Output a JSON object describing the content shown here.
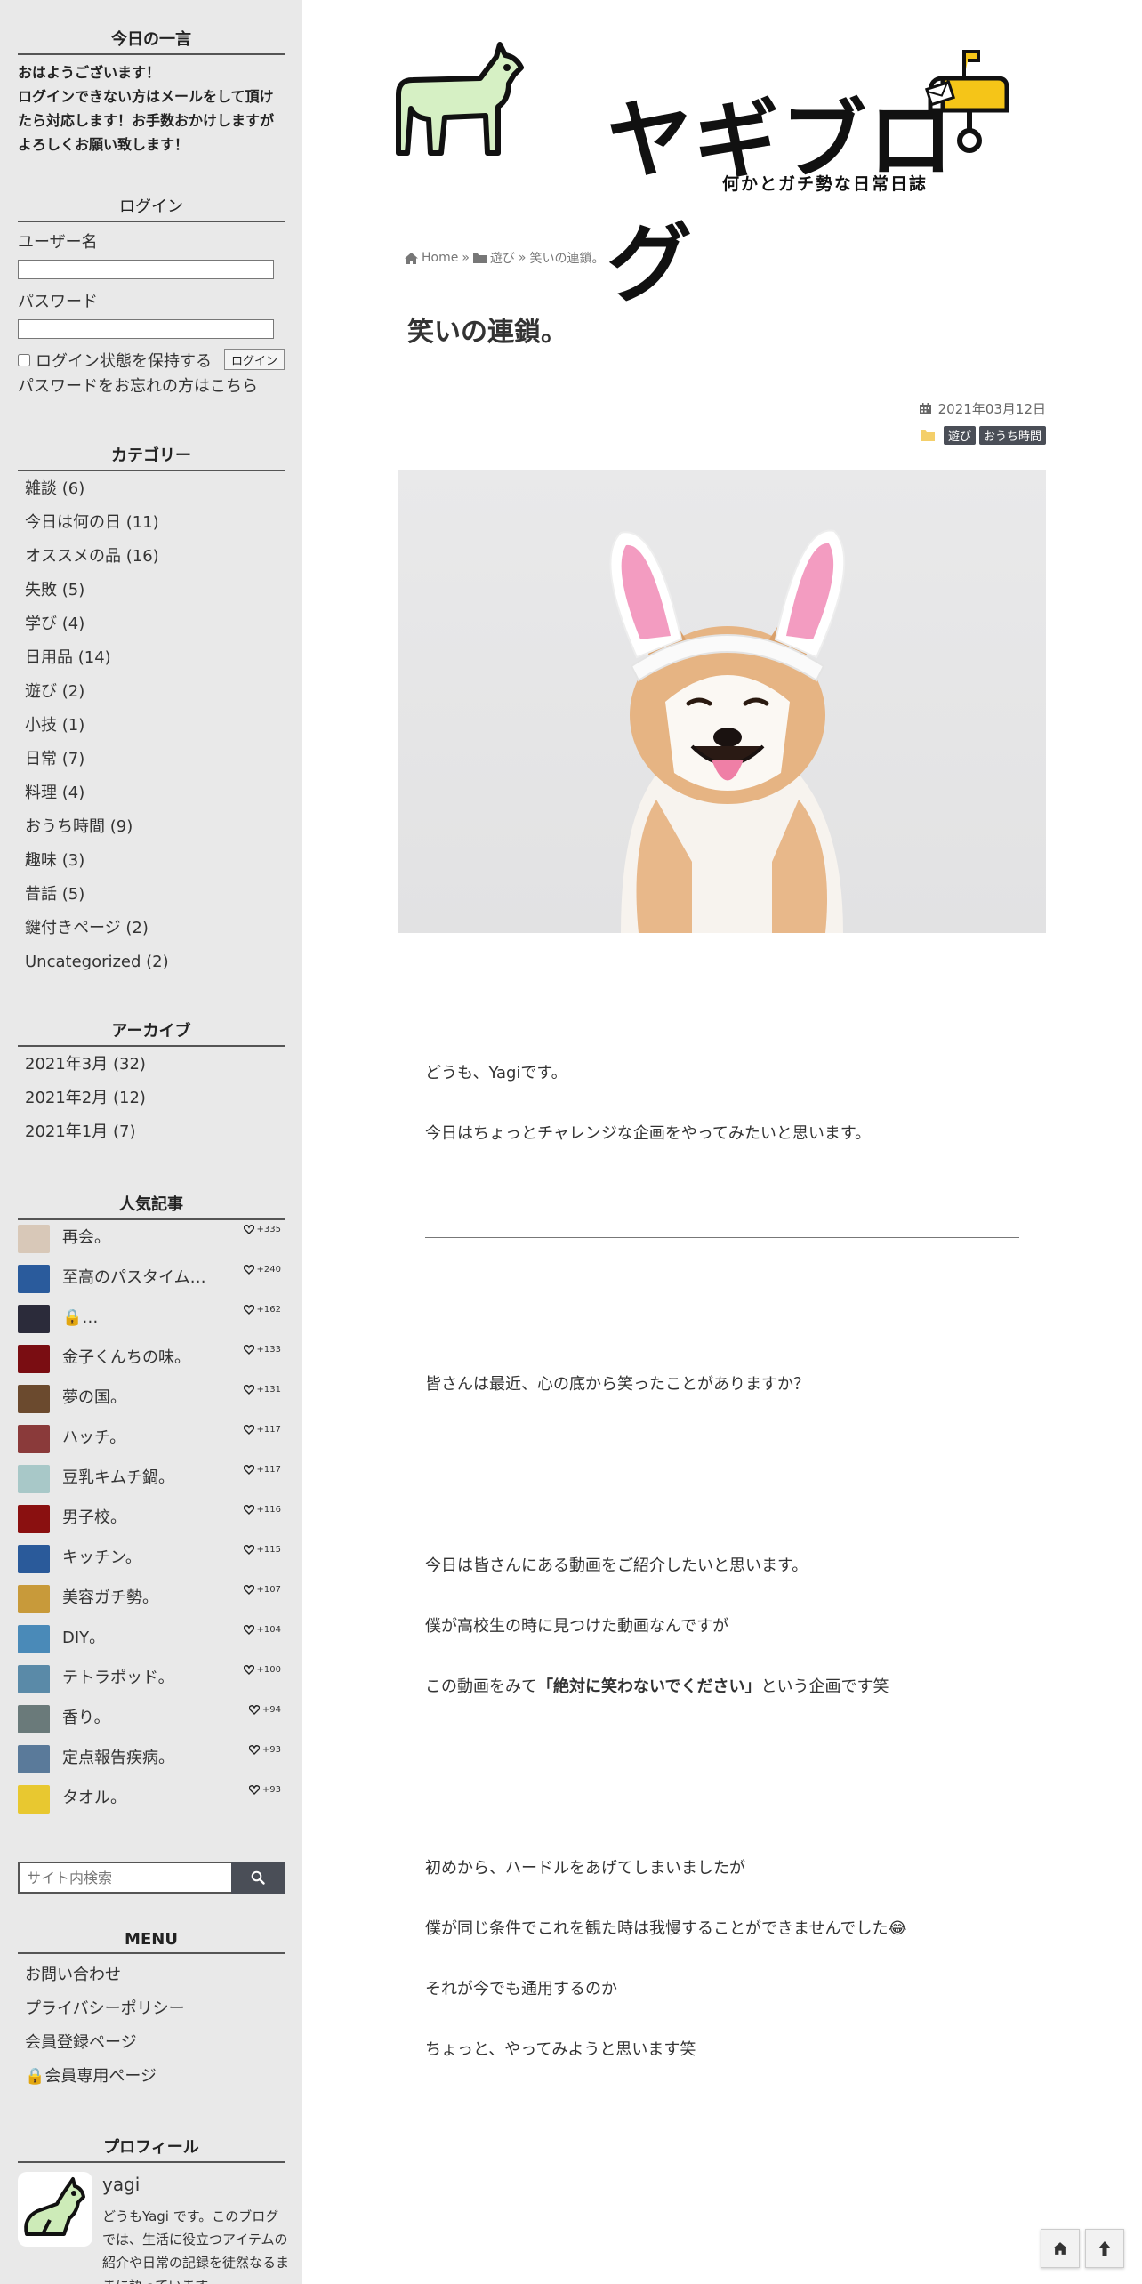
{
  "sidebar": {
    "greeting": {
      "title": "今日の一言",
      "lines": [
        "おはようございます！",
        "ログインできない方はメールをして頂け",
        "たら対応します！お手数おかけしますが",
        "よろしくお願い致します！"
      ]
    },
    "login": {
      "title": "ログイン",
      "username_label": "ユーザー名",
      "password_label": "パスワード",
      "remember_label": "ログイン状態を保持する",
      "login_button": "ログイン",
      "forgot_link": "パスワードをお忘れの方はこちら"
    },
    "categories": {
      "title": "カテゴリー",
      "items": [
        "雑談 (6)",
        "今日は何の日 (11)",
        "オススメの品 (16)",
        "失敗 (5)",
        "学び (4)",
        "日用品 (14)",
        "遊び (2)",
        "小技 (1)",
        "日常 (7)",
        "料理 (4)",
        "おうち時間 (9)",
        "趣味 (3)",
        "昔話 (5)",
        "鍵付きページ (2)",
        "Uncategorized (2)"
      ]
    },
    "archive": {
      "title": "アーカイブ",
      "items": [
        "2021年3月 (32)",
        "2021年2月 (12)",
        "2021年1月 (7)"
      ]
    },
    "popular": {
      "title": "人気記事",
      "items": [
        {
          "title": "再会。",
          "count": "+335",
          "color": "#d8c8b8"
        },
        {
          "title": "至高のパスタイム…",
          "count": "+240",
          "color": "#2a5b9c"
        },
        {
          "title": "🔒…",
          "count": "+162",
          "color": "#2b2b3a"
        },
        {
          "title": "金子くんちの味。",
          "count": "+133",
          "color": "#7a0d12"
        },
        {
          "title": "夢の国。",
          "count": "+131",
          "color": "#6b4a2e"
        },
        {
          "title": "ハッチ。",
          "count": "+117",
          "color": "#8a3a3a"
        },
        {
          "title": "豆乳キムチ鍋。",
          "count": "+117",
          "color": "#a8c8c8"
        },
        {
          "title": "男子校。",
          "count": "+116",
          "color": "#8a1010"
        },
        {
          "title": "キッチン。",
          "count": "+115",
          "color": "#2a5a9a"
        },
        {
          "title": "美容ガチ勢。",
          "count": "+107",
          "color": "#c89a3a"
        },
        {
          "title": "DIY。",
          "count": "+104",
          "color": "#4a8ab8"
        },
        {
          "title": "テトラポッド。",
          "count": "+100",
          "color": "#5a8aa8"
        },
        {
          "title": "香り。",
          "count": "+94",
          "color": "#6a7a7a"
        },
        {
          "title": "定点報告疾病。",
          "count": "+93",
          "color": "#5a7a9a"
        },
        {
          "title": "タオル。",
          "count": "+93",
          "color": "#e8c830"
        }
      ]
    },
    "search": {
      "placeholder": "サイト内検索"
    },
    "menu": {
      "title": "MENU",
      "items": [
        "お問い合わせ",
        "プライバシーポリシー",
        "会員登録ページ",
        "🔒会員専用ページ"
      ]
    },
    "profile": {
      "title": "プロフィール",
      "name": "yagi",
      "desc": "どうもYagi です。このブログでは、生活に役立つアイテムの紹介や日常の記録を徒然なるままに語っています。"
    }
  },
  "header": {
    "logo_title": "ヤギブログ",
    "logo_subtitle": "何かとガチ勢な日常日誌"
  },
  "breadcrumb": {
    "home": "Home",
    "sep": "»",
    "category": "遊び",
    "current": "笑いの連鎖。"
  },
  "post": {
    "title": "笑いの連鎖。",
    "date": "2021年03月12日",
    "tags": [
      "遊び",
      "おうち時間"
    ],
    "paragraphs": {
      "p1": "どうも、Yagiです。",
      "p2": "今日はちょっとチャレンジな企画をやってみたいと思います。",
      "p3": "皆さんは最近、心の底から笑ったことがありますか？",
      "p4": "今日は皆さんにある動画をご紹介したいと思います。",
      "p5": "僕が高校生の時に見つけた動画なんですが",
      "p6_pre": "この動画をみて",
      "p6_bold": "「絶対に笑わないでください」",
      "p6_post": "という企画です笑",
      "p7": "初めから、ハードルをあげてしまいましたが",
      "p8": "僕が同じ条件でこれを観た時は我慢することができませんでした😂",
      "p9": "それが今でも通用するのか",
      "p10": "ちょっと、やってみようと思います笑"
    }
  },
  "colors": {
    "sidebar_bg": "#e9e9e9",
    "tag_bg": "#4a4e57",
    "logo_goat": "#d6f0c4",
    "logo_mailbox": "#f5c518"
  }
}
